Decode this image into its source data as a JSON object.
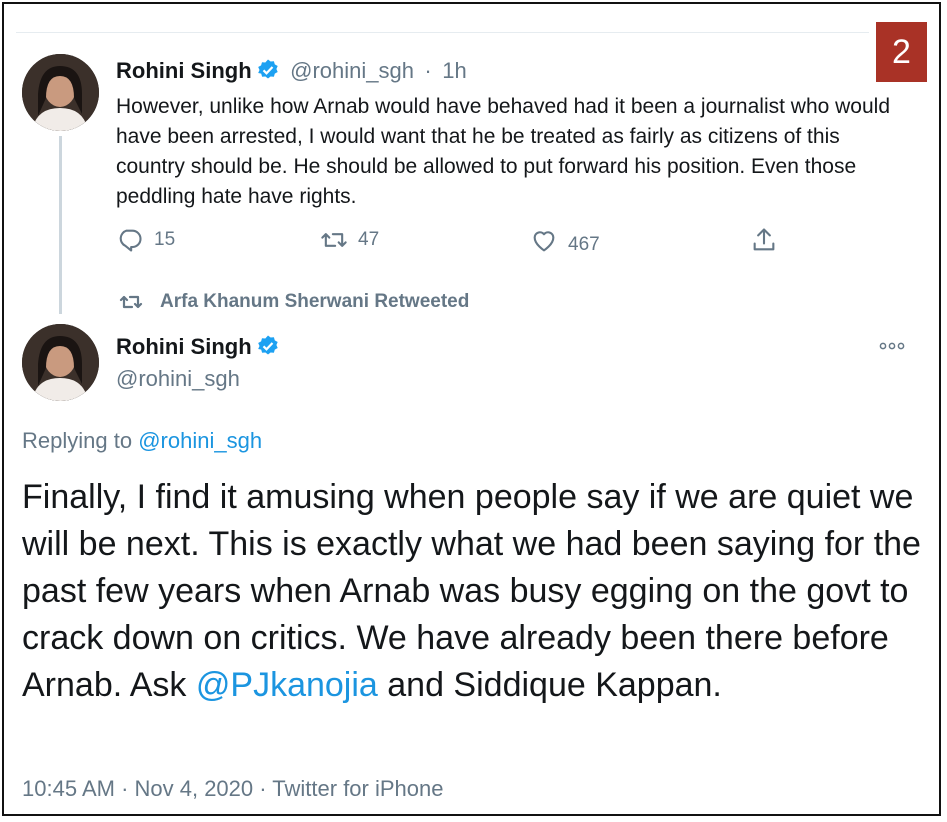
{
  "badge_number": "2",
  "tweet1": {
    "name": "Rohini Singh",
    "handle": "@rohini_sgh",
    "separator": "·",
    "time": "1h",
    "text": "However, unlike how Arnab would have behaved had it been a journalist who would have been arrested, I would want that he be treated as fairly as citizens of this country should be. He should be allowed to put forward his position. Even those peddling hate have rights.",
    "replies": "15",
    "retweets": "47",
    "likes": "467"
  },
  "retweet_banner": "Arfa Khanum Sherwani Retweeted",
  "tweet2": {
    "name": "Rohini Singh",
    "handle": "@rohini_sgh",
    "replying_prefix": "Replying to",
    "replying_handle": "@rohini_sgh",
    "text_part1": "Finally, I find it amusing when people say if we are quiet we will be next. This is exactly what we had been saying for the past few years when Arnab was busy egging on the govt to crack down on critics. We have already been there before Arnab. Ask ",
    "mention": "@PJkanojia",
    "text_part2": " and Siddique Kappan.",
    "timestamp": "10:45 AM · Nov 4, 2020 · Twitter for iPhone"
  },
  "colors": {
    "link": "#1b95e0",
    "verified": "#1da1f2",
    "badge": "#a93226",
    "muted": "#657786"
  },
  "icons": [
    "reply-icon",
    "retweet-icon",
    "like-icon",
    "share-icon",
    "verified-icon",
    "more-icon"
  ]
}
